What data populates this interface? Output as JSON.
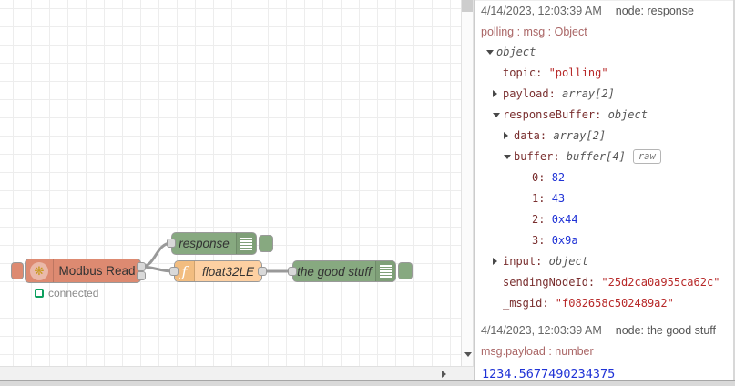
{
  "canvas": {
    "nodes": {
      "modbus": {
        "label": "Modbus Read",
        "status_text": "connected",
        "icon_glyph": "❋"
      },
      "response": {
        "label": "response"
      },
      "function": {
        "label": "float32LE",
        "icon_glyph": "ƒ"
      },
      "good_stuff": {
        "label": "the good stuff"
      }
    },
    "colors": {
      "modbus_node": "#dd8a71",
      "debug_node": "#87a980",
      "function_node": "#fdd0a2",
      "status_green": "#0ea05f",
      "wire": "#999999"
    }
  },
  "debug_panel": {
    "colors": {
      "key": "#792e2e",
      "string": "#b72828",
      "number": "#2033d6",
      "meta_path": "#aa6666"
    },
    "messages": [
      {
        "timestamp": "4/14/2023, 12:03:39 AM",
        "node": "node: response",
        "path": "polling : msg : Object",
        "rows": [
          {
            "indent": 1,
            "arrow": "down",
            "value": "object",
            "vclass": "type"
          },
          {
            "indent": 2,
            "key": "topic",
            "value": "\"polling\"",
            "vclass": "string"
          },
          {
            "indent": 2,
            "arrow": "right",
            "key": "payload",
            "value": "array[2]",
            "vclass": "type"
          },
          {
            "indent": 2,
            "arrow": "down",
            "key": "responseBuffer",
            "value": "object",
            "vclass": "type"
          },
          {
            "indent": 3,
            "arrow": "right",
            "key": "data",
            "value": "array[2]",
            "vclass": "type"
          },
          {
            "indent": 3,
            "arrow": "down",
            "key": "buffer",
            "value": "buffer[4]",
            "vclass": "type",
            "badge": "raw"
          },
          {
            "indent": 4,
            "key": "0",
            "value": "82",
            "vclass": "number"
          },
          {
            "indent": 4,
            "key": "1",
            "value": "43",
            "vclass": "number"
          },
          {
            "indent": 4,
            "key": "2",
            "value": "0x44",
            "vclass": "number"
          },
          {
            "indent": 4,
            "key": "3",
            "value": "0x9a",
            "vclass": "number"
          },
          {
            "indent": 2,
            "arrow": "right",
            "key": "input",
            "value": "object",
            "vclass": "type"
          },
          {
            "indent": 2,
            "key": "sendingNodeId",
            "value": "\"25d2ca0a955ca62c\"",
            "vclass": "string"
          },
          {
            "indent": 2,
            "key": "_msgid",
            "value": "\"f082658c502489a2\"",
            "vclass": "string"
          }
        ]
      },
      {
        "timestamp": "4/14/2023, 12:03:39 AM",
        "node": "node: the good stuff",
        "path": "msg.payload : number",
        "big_value": "1234.5677490234375"
      }
    ]
  }
}
